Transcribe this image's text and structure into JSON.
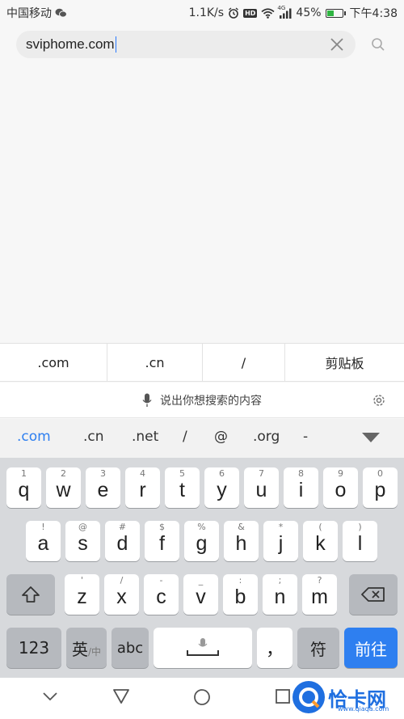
{
  "status_bar": {
    "carrier": "中国移动",
    "speed": "1.1K/s",
    "hd": "HD",
    "network_tag": "4G",
    "battery": "45%",
    "battery_level": 0.45,
    "time": "下午4:38"
  },
  "search": {
    "value": "sviphome.com"
  },
  "suggestions": [
    ".com",
    ".cn",
    "/",
    "剪贴板"
  ],
  "voice_prompt": "说出你想搜索的内容",
  "quick_keys": [
    ".com",
    ".cn",
    ".net",
    "/",
    "@",
    ".org",
    "-"
  ],
  "keyboard": {
    "row1": [
      {
        "k": "q",
        "h": "1"
      },
      {
        "k": "w",
        "h": "2"
      },
      {
        "k": "e",
        "h": "3"
      },
      {
        "k": "r",
        "h": "4"
      },
      {
        "k": "t",
        "h": "5"
      },
      {
        "k": "y",
        "h": "6"
      },
      {
        "k": "u",
        "h": "7"
      },
      {
        "k": "i",
        "h": "8"
      },
      {
        "k": "o",
        "h": "9"
      },
      {
        "k": "p",
        "h": "0"
      }
    ],
    "row2": [
      {
        "k": "a",
        "h": "!"
      },
      {
        "k": "s",
        "h": "@"
      },
      {
        "k": "d",
        "h": "#"
      },
      {
        "k": "f",
        "h": "$"
      },
      {
        "k": "g",
        "h": "%"
      },
      {
        "k": "h",
        "h": "&"
      },
      {
        "k": "j",
        "h": "*"
      },
      {
        "k": "k",
        "h": "("
      },
      {
        "k": "l",
        "h": ")"
      }
    ],
    "row3": [
      {
        "k": "z",
        "h": "'"
      },
      {
        "k": "x",
        "h": "/"
      },
      {
        "k": "c",
        "h": "-"
      },
      {
        "k": "v",
        "h": "_"
      },
      {
        "k": "b",
        "h": ":"
      },
      {
        "k": "n",
        "h": ";"
      },
      {
        "k": "m",
        "h": "?"
      }
    ],
    "num_key": "123",
    "lang_key": "英",
    "lang_key_sub": "/中",
    "abc_key": "abc",
    "comma_key": "，",
    "symbol_key": "符",
    "go_key": "前往"
  },
  "watermark": {
    "brand": "恰卡网",
    "url": "www.qiaqa.com"
  },
  "colors": {
    "accent": "#2e7ff0",
    "battery_fill": "#2fb542",
    "key_bg": "#ffffff",
    "key_gray": "#b6b9be",
    "keyboard_bg": "#d7d9dc"
  }
}
